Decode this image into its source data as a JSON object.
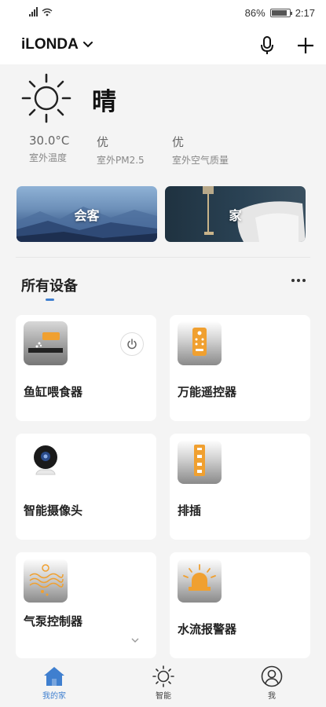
{
  "status": {
    "battery": "86%",
    "time": "2:17",
    "network": "3G",
    "battery_level": 0.86
  },
  "header": {
    "home_name": "iLONDA"
  },
  "weather": {
    "condition": "晴",
    "stats": [
      {
        "value": "30.0°C",
        "label": "室外温度"
      },
      {
        "value": "优",
        "label": "室外PM2.5"
      },
      {
        "value": "优",
        "label": "室外空气质量"
      }
    ]
  },
  "scenes": [
    {
      "name": "会客"
    },
    {
      "name": "家"
    }
  ],
  "devices_section": {
    "title": "所有设备"
  },
  "devices": [
    {
      "name": "鱼缸喂食器",
      "icon": "feeder-icon"
    },
    {
      "name": "万能遥控器",
      "icon": "remote-icon"
    },
    {
      "name": "智能摄像头",
      "icon": "camera-icon"
    },
    {
      "name": "排插",
      "icon": "power-strip-icon"
    },
    {
      "name": "气泵控制器",
      "icon": "air-pump-icon"
    },
    {
      "name": "水流报警器",
      "icon": "alarm-icon"
    }
  ],
  "nav": [
    {
      "label": "我的家",
      "icon": "home-icon"
    },
    {
      "label": "智能",
      "icon": "sun-icon"
    },
    {
      "label": "我",
      "icon": "profile-icon"
    }
  ],
  "colors": {
    "accent": "#3f7fcf",
    "background": "#f4f4f4"
  }
}
